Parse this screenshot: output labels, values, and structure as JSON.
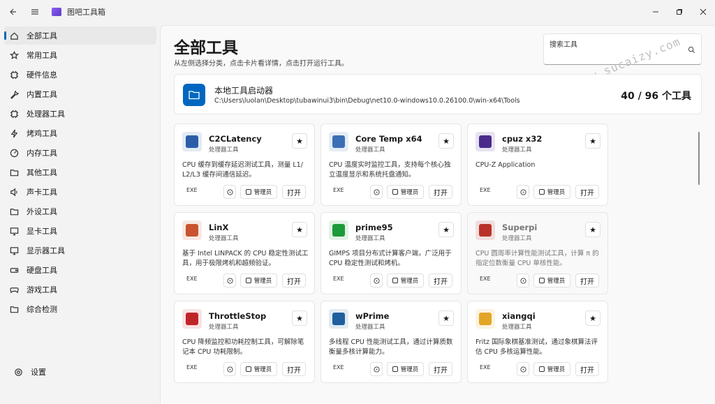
{
  "app": {
    "title": "图吧工具箱"
  },
  "sidebar": {
    "items": [
      {
        "label": "全部工具",
        "icon": "home-icon",
        "active": true
      },
      {
        "label": "常用工具",
        "icon": "star-icon"
      },
      {
        "label": "硬件信息",
        "icon": "chip-icon"
      },
      {
        "label": "内置工具",
        "icon": "wrench-icon"
      },
      {
        "label": "处理器工具",
        "icon": "chip-icon"
      },
      {
        "label": "烤鸡工具",
        "icon": "flash-icon"
      },
      {
        "label": "内存工具",
        "icon": "gauge-icon"
      },
      {
        "label": "其他工具",
        "icon": "folder-icon"
      },
      {
        "label": "声卡工具",
        "icon": "speaker-icon"
      },
      {
        "label": "外设工具",
        "icon": "folder-icon"
      },
      {
        "label": "显卡工具",
        "icon": "monitor-icon"
      },
      {
        "label": "显示器工具",
        "icon": "monitor-icon"
      },
      {
        "label": "硬盘工具",
        "icon": "drive-icon"
      },
      {
        "label": "游戏工具",
        "icon": "gamepad-icon"
      },
      {
        "label": "综合检测",
        "icon": "folder-icon"
      }
    ],
    "settings_label": "设置"
  },
  "main": {
    "title": "全部工具",
    "subtitle": "从左侧选择分类，点击卡片看详情，点击打开运行工具。",
    "search_placeholder": "搜索工具",
    "watermark": "www.sucaizy.com",
    "launcher": {
      "title": "本地工具启动器",
      "path": "C:\\Users\\luolan\\Desktop\\tubawinui3\\bin\\Debug\\net10.0-windows10.0.26100.0\\win-x64\\Tools",
      "count": "40 / 96 个工具"
    }
  },
  "cards": [
    {
      "name": "C2CLatency",
      "category": "处理器工具",
      "desc": "CPU 缓存到缓存延迟测试工具，测量 L1/ L2/L3 缓存间通信延迟。",
      "ext": "EXE",
      "admin_label": "管理员",
      "open_label": "打开",
      "icon_color": "#2a5ea8",
      "dim": false
    },
    {
      "name": "Core Temp x64",
      "category": "处理器工具",
      "desc": "CPU 温度实时监控工具，支持每个核心独立温度显示和系统托盘通知。",
      "ext": "EXE",
      "admin_label": "管理员",
      "open_label": "打开",
      "icon_color": "#3b6fb5",
      "dim": false
    },
    {
      "name": "cpuz x32",
      "category": "处理器工具",
      "desc": "CPU-Z Application",
      "ext": "EXE",
      "admin_label": "管理员",
      "open_label": "打开",
      "icon_color": "#4a2b8c",
      "dim": false
    },
    {
      "name": "LinX",
      "category": "处理器工具",
      "desc": "基于 Intel LINPACK 的 CPU 稳定性测试工具，用于极限烤机和超频验证。",
      "ext": "EXE",
      "admin_label": "管理员",
      "open_label": "打开",
      "icon_color": "#c9532f",
      "dim": false
    },
    {
      "name": "prime95",
      "category": "处理器工具",
      "desc": "GIMPS 项目分布式计算客户端，广泛用于 CPU 稳定性测试和烤机。",
      "ext": "EXE",
      "admin_label": "管理员",
      "open_label": "打开",
      "icon_color": "#1d9a3a",
      "dim": false
    },
    {
      "name": "Superpi",
      "category": "处理器工具",
      "desc": "CPU 圆周率计算性能测试工具，计算 π 的指定位数衡量 CPU 单核性能。",
      "ext": "EXE",
      "admin_label": "管理员",
      "open_label": "打开",
      "icon_color": "#b8322a",
      "dim": true
    },
    {
      "name": "ThrottleStop",
      "category": "处理器工具",
      "desc": "CPU 降频监控和功耗控制工具，可解除笔记本 CPU 功耗限制。",
      "ext": "EXE",
      "admin_label": "管理员",
      "open_label": "打开",
      "icon_color": "#c0242b",
      "dim": false
    },
    {
      "name": "wPrime",
      "category": "处理器工具",
      "desc": "多线程 CPU 性能测试工具，通过计算质数衡量多核计算能力。",
      "ext": "EXE",
      "admin_label": "管理员",
      "open_label": "打开",
      "icon_color": "#1f5f9e",
      "dim": false
    },
    {
      "name": "xiangqi",
      "category": "处理器工具",
      "desc": "Fritz 国际象棋基准测试，通过象棋算法评估 CPU 多核运算性能。",
      "ext": "EXE",
      "admin_label": "管理员",
      "open_label": "打开",
      "icon_color": "#e3a526",
      "dim": false
    }
  ],
  "colors": {
    "accent": "#0067c0",
    "background": "#f3f3f3",
    "card": "#ffffff"
  }
}
